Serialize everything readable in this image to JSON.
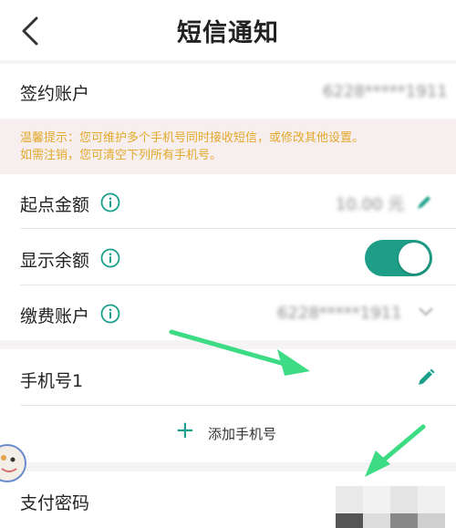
{
  "header": {
    "title": "短信通知",
    "back_icon": "chevron-left-icon"
  },
  "contract_account": {
    "label": "签约账户",
    "value": "6228*****1911"
  },
  "tip": {
    "line1": "温馨提示：您可维护多个手机号同时接收短信，或修改其他设置。",
    "line2": "如需注销，您可清空下列所有手机号。",
    "color": "#e2a92a"
  },
  "start_amount": {
    "label": "起点金额",
    "value": "10.00 元"
  },
  "show_balance": {
    "label": "显示余额",
    "enabled": true
  },
  "fee_account": {
    "label": "缴费账户",
    "value": "6228*****1911"
  },
  "phone1": {
    "label": "手机号1"
  },
  "add_phone": {
    "label": "添加手机号"
  },
  "pay_password": {
    "label": "支付密码"
  },
  "colors": {
    "accent": "#1e9e86",
    "arrow": "#3ddc84"
  }
}
